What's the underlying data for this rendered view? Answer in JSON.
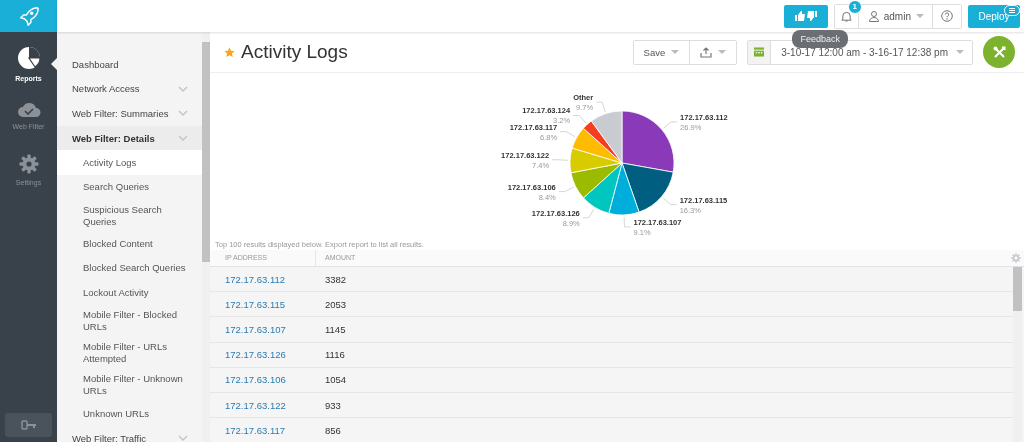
{
  "rail": [
    {
      "label": "Reports",
      "kind": "reports",
      "selected": true
    },
    {
      "label": "Web Filter",
      "kind": "cloud",
      "selected": false
    },
    {
      "label": "Settings",
      "kind": "gear",
      "selected": false
    }
  ],
  "topbar": {
    "badge": "1",
    "user": "admin",
    "deploy": "Deploy",
    "tooltip": "Feedback"
  },
  "nav": [
    {
      "label": "Dashboard",
      "kind": "link"
    },
    {
      "label": "Network Access",
      "kind": "group",
      "expanded": false
    },
    {
      "label": "Web Filter: Summaries",
      "kind": "group",
      "expanded": false
    },
    {
      "label": "Web Filter: Details",
      "kind": "group",
      "expanded": true,
      "children": [
        {
          "label": "Activity Logs",
          "selected": true
        },
        {
          "label": "Search Queries",
          "selected": false
        },
        {
          "label": "Suspicious Search Queries",
          "selected": false
        },
        {
          "label": "Blocked Content",
          "selected": false
        },
        {
          "label": "Blocked Search Queries",
          "selected": false
        },
        {
          "label": "Lockout Activity",
          "selected": false
        },
        {
          "label": "Mobile Filter - Blocked URLs",
          "selected": false
        },
        {
          "label": "Mobile Filter - URLs Attempted",
          "selected": false
        },
        {
          "label": "Mobile Filter - Unknown URLs",
          "selected": false
        },
        {
          "label": "Unknown URLs",
          "selected": false
        }
      ]
    },
    {
      "label": "Web Filter: Traffic",
      "kind": "group",
      "expanded": false
    }
  ],
  "page": {
    "title": "Activity Logs",
    "save": "Save",
    "date_range": "3-10-17 12:00 am - 3-16-17 12:38 pm"
  },
  "chart": {
    "chart_data": {
      "type": "pie",
      "categories": [
        "172.17.63.112",
        "172.17.63.115",
        "172.17.63.107",
        "172.17.63.126",
        "172.17.63.106",
        "172.17.63.122",
        "172.17.63.117",
        "172.17.63.124",
        "Other"
      ],
      "values": [
        26.9,
        16.3,
        9.1,
        8.9,
        8.4,
        7.4,
        6.8,
        3.2,
        9.7
      ],
      "value_labels": [
        "26.9%",
        "16.3%",
        "9.1%",
        "8.9%",
        "8.4%",
        "7.4%",
        "6.8%",
        "3.2%",
        "9.7%"
      ]
    }
  },
  "table": {
    "note": "Top 100 results displayed below. Export report to list all results.",
    "columns": [
      "IP ADDRESS",
      "AMOUNT"
    ],
    "rows": [
      [
        "172.17.63.112",
        "3382"
      ],
      [
        "172.17.63.115",
        "2053"
      ],
      [
        "172.17.63.107",
        "1145"
      ],
      [
        "172.17.63.126",
        "1116"
      ],
      [
        "172.17.63.106",
        "1054"
      ],
      [
        "172.17.63.122",
        "933"
      ],
      [
        "172.17.63.117",
        "856"
      ]
    ]
  }
}
